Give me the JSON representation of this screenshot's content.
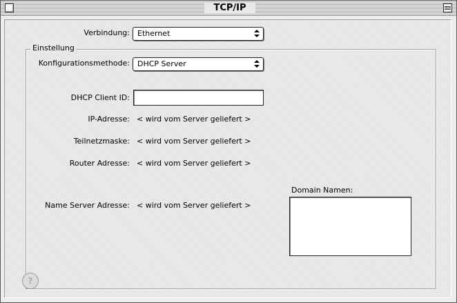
{
  "window": {
    "title": "TCP/IP"
  },
  "connection": {
    "label": "Verbindung:",
    "value": "Ethernet"
  },
  "settings": {
    "group_label": "Einstellung",
    "config_method_label": "Konfigurationsmethode:",
    "config_method_value": "DHCP Server",
    "dhcp_client_id_label": "DHCP Client ID:",
    "dhcp_client_id_value": "",
    "ip_label": "IP-Adresse:",
    "ip_value": "< wird vom Server geliefert >",
    "subnet_label": "Teilnetzmaske:",
    "subnet_value": "< wird vom Server geliefert >",
    "router_label": "Router Adresse:",
    "router_value": "< wird vom Server geliefert >",
    "nameserver_label": "Name Server Adresse:",
    "nameserver_value": "< wird vom Server geliefert >",
    "domain_names_label": "Domain Namen:",
    "domain_names_value": ""
  },
  "icons": {
    "help": "help-icon",
    "close": "close-box-icon",
    "collapse": "collapse-box-icon"
  }
}
